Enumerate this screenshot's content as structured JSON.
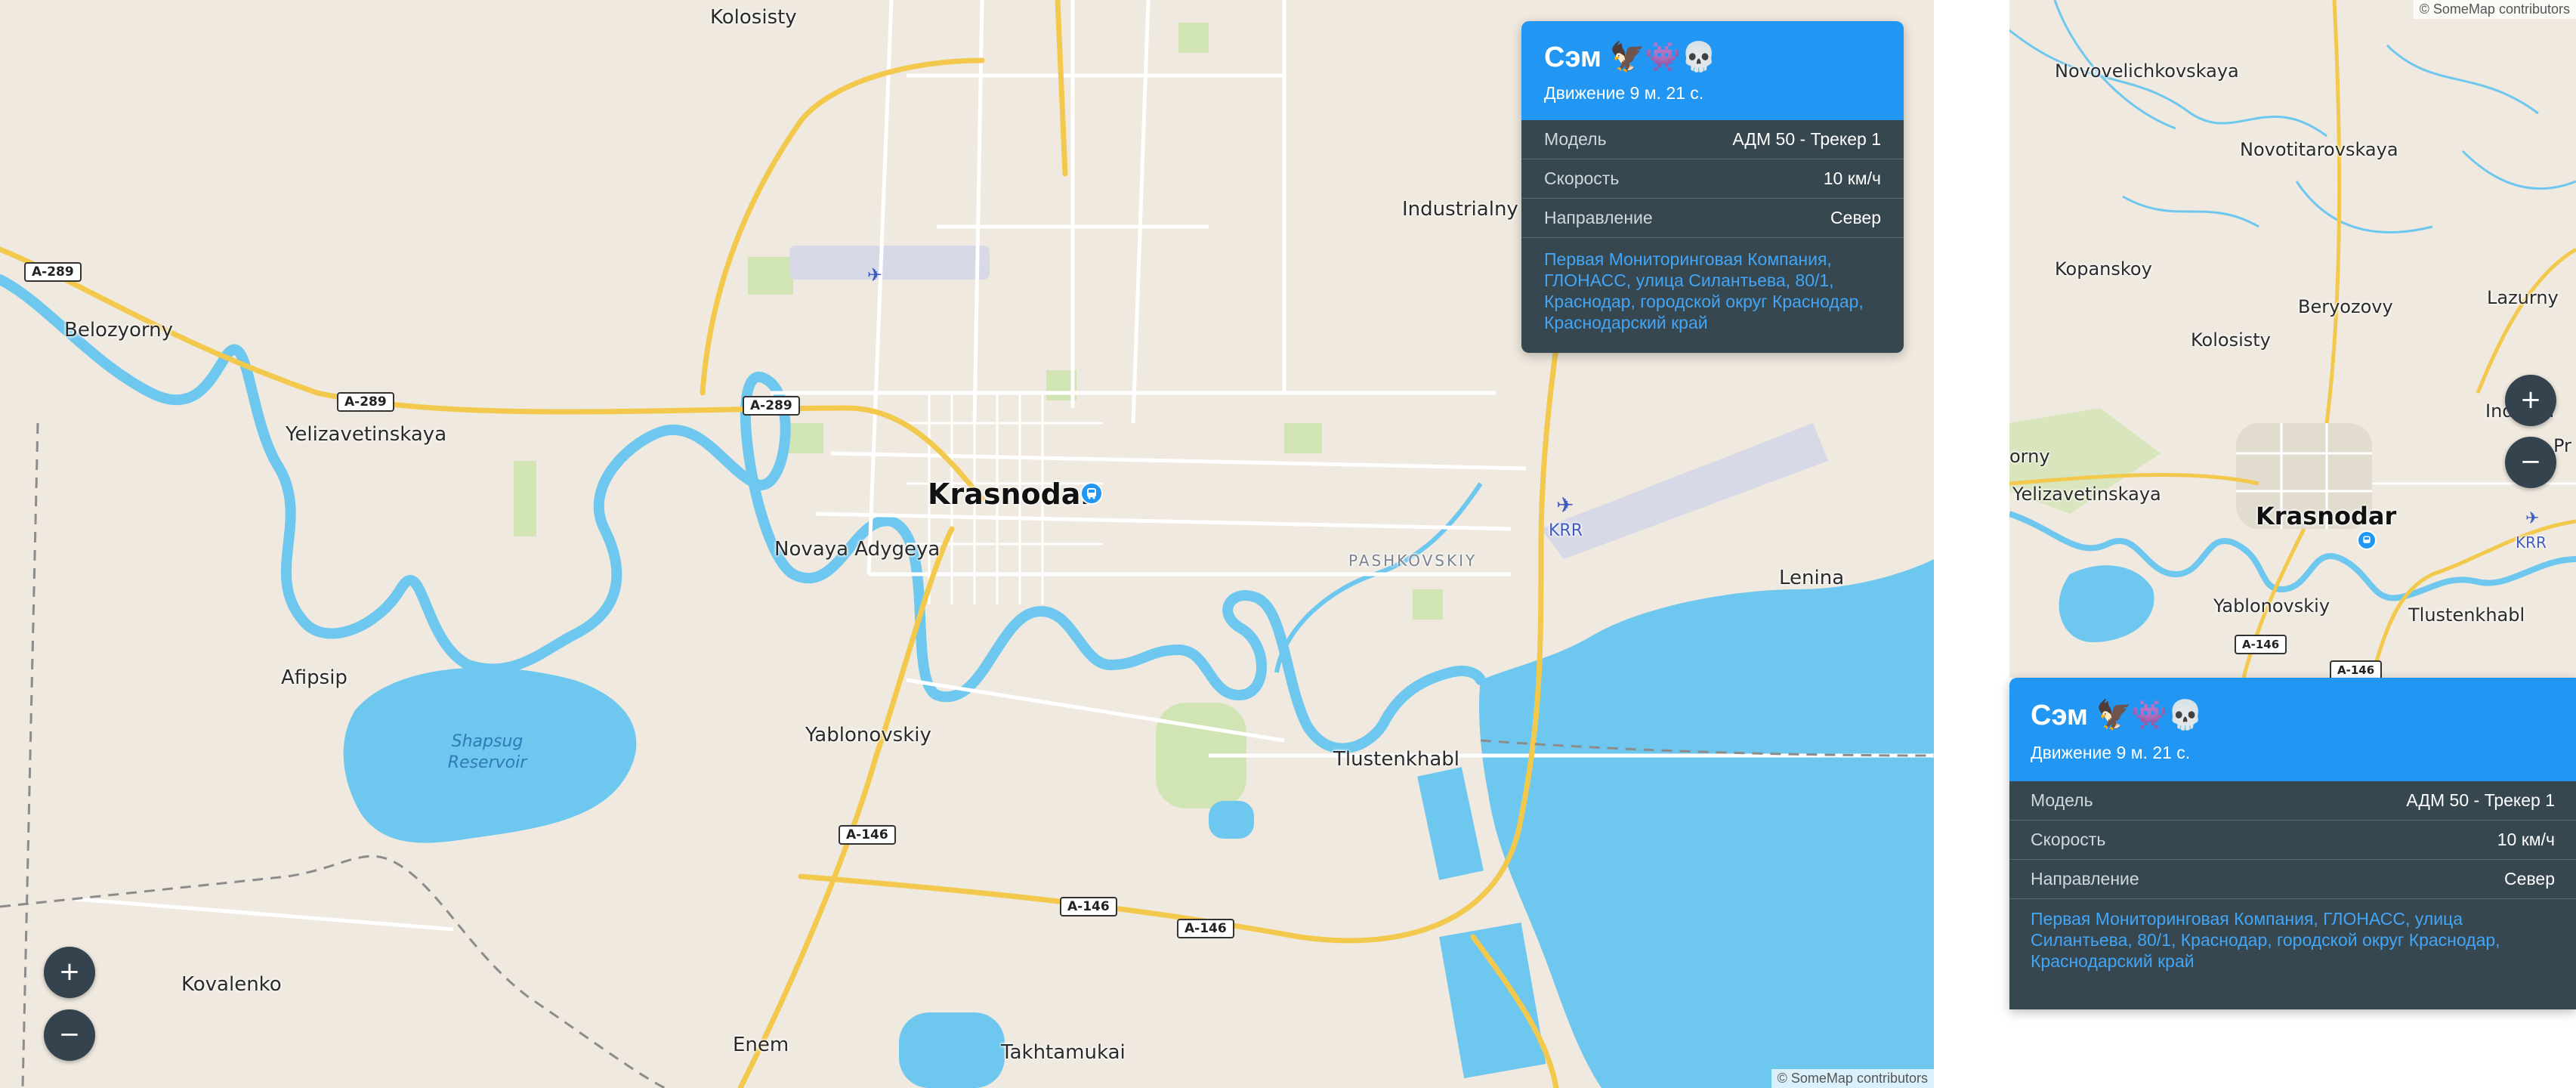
{
  "map": {
    "attribution": "© SomeMap contributors",
    "zoom_in_label": "+",
    "zoom_out_label": "−",
    "colors": {
      "land": "#efe9df",
      "water": "#6ec7ee",
      "road_major": "#f2c94c",
      "road_minor": "#ffffff",
      "park": "#c8e3a7",
      "accent": "#2196f3"
    },
    "places": {
      "kolosisty": "Kolosisty",
      "belozyorny": "Belozyorny",
      "yelizavetinskaya": "Yelizavetinskaya",
      "novaya_adygeya": "Novaya Adygeya",
      "krasnodar": "Krasnodar",
      "industrialny": "Industrialny",
      "pashkovskiy": "PASHKOVSKIY",
      "krr": "KRR",
      "lenina": "Lenina",
      "afipsip": "Afipsip",
      "shapsug": "Shapsug Reservoir",
      "yablonovskiy": "Yablonovskiy",
      "tlustenkhabl": "Tlustenkhabl",
      "kovalenko": "Kovalenko",
      "enem": "Enem",
      "takhtamukai": "Takhtamukai"
    },
    "shields": {
      "a289": "A-289",
      "a146": "A-146"
    }
  },
  "minimap": {
    "attribution": "© SomeMap contributors",
    "zoom_in_label": "+",
    "zoom_out_label": "−",
    "places": {
      "novovelichkovskaya": "Novovelichkovskaya",
      "novotitarovskaya": "Novotitarovskaya",
      "kopanskoy": "Kopanskoy",
      "beryozovy": "Beryozovy",
      "lazurny": "Lazurny",
      "kolosisty": "Kolosisty",
      "industrialny_partial": "Industri",
      "pr_partial": "Pr",
      "orny_partial": "orny",
      "yelizavetinskaya": "Yelizavetinskaya",
      "krasnodar": "Krasnodar",
      "krr": "KRR",
      "yablonovskiy": "Yablonovskiy",
      "tlustenkhabl": "Tlustenkhabl"
    },
    "shields": {
      "a146": "A-146"
    }
  },
  "popup": {
    "title": "Сэм 🦅👾💀",
    "subtitle": "Движение 9 м. 21 с.",
    "rows": [
      {
        "key": "Модель",
        "value": "АДМ 50 - Трекер 1"
      },
      {
        "key": "Скорость",
        "value": "10 км/ч"
      },
      {
        "key": "Направление",
        "value": "Север"
      }
    ],
    "address": "Первая Мониторинговая Компания, ГЛОНАСС, улица Силантьева, 80/1, Краснодар, городской округ Краснодар, Краснодарский край"
  }
}
